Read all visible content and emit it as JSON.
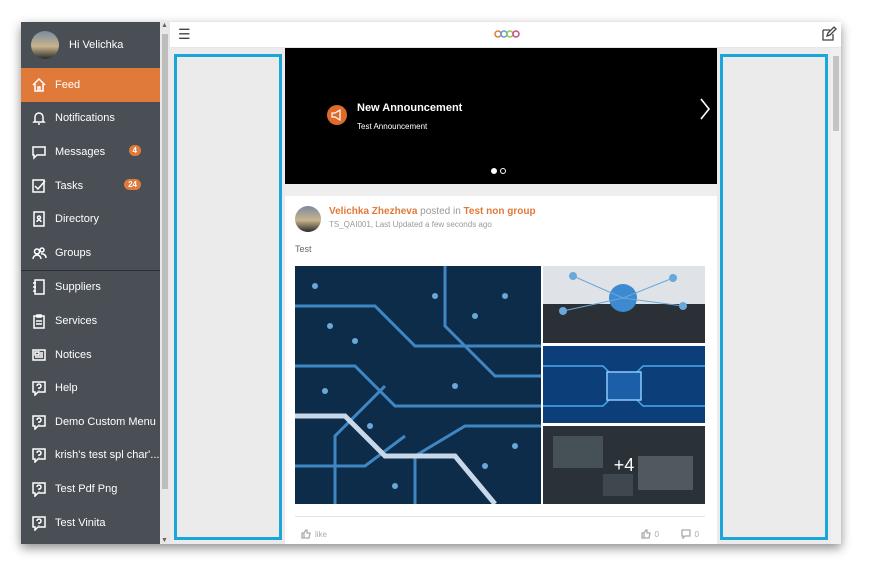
{
  "profile": {
    "greeting": "Hi Velichka"
  },
  "nav": [
    {
      "label": "Feed",
      "icon": "home-icon",
      "active": true
    },
    {
      "label": "Notifications",
      "icon": "bell-icon"
    },
    {
      "label": "Messages",
      "icon": "chat-icon",
      "badge": "4"
    },
    {
      "label": "Tasks",
      "icon": "checkbox-icon",
      "badge": "24"
    },
    {
      "label": "Directory",
      "icon": "contact-card-icon"
    },
    {
      "label": "Groups",
      "icon": "group-icon"
    },
    {
      "label": "Suppliers",
      "icon": "notebook-icon"
    },
    {
      "label": "Services",
      "icon": "clipboard-icon"
    },
    {
      "label": "Notices",
      "icon": "newspaper-icon"
    },
    {
      "label": "Help",
      "icon": "question-icon"
    },
    {
      "label": "Demo Custom Menu",
      "icon": "question-icon"
    },
    {
      "label": "krish's test spl char'...",
      "icon": "question-icon"
    },
    {
      "label": "Test Pdf Png",
      "icon": "question-icon"
    },
    {
      "label": "Test Vinita",
      "icon": "question-icon"
    }
  ],
  "banner": {
    "title": "New Announcement",
    "subtitle": "Test Announcement"
  },
  "post": {
    "author": "Velichka Zhezheva",
    "posted_in": "posted in",
    "group": "Test non group",
    "meta": "TS_QAI001, Last Updated a few seconds ago",
    "text": "Test",
    "more_images": "+4",
    "like_label": "like",
    "like_count": "0",
    "comment_count": "0"
  },
  "colors": {
    "accent": "#e07a3a",
    "sidebar": "#4a4f55",
    "highlight": "#1aa6d6"
  }
}
